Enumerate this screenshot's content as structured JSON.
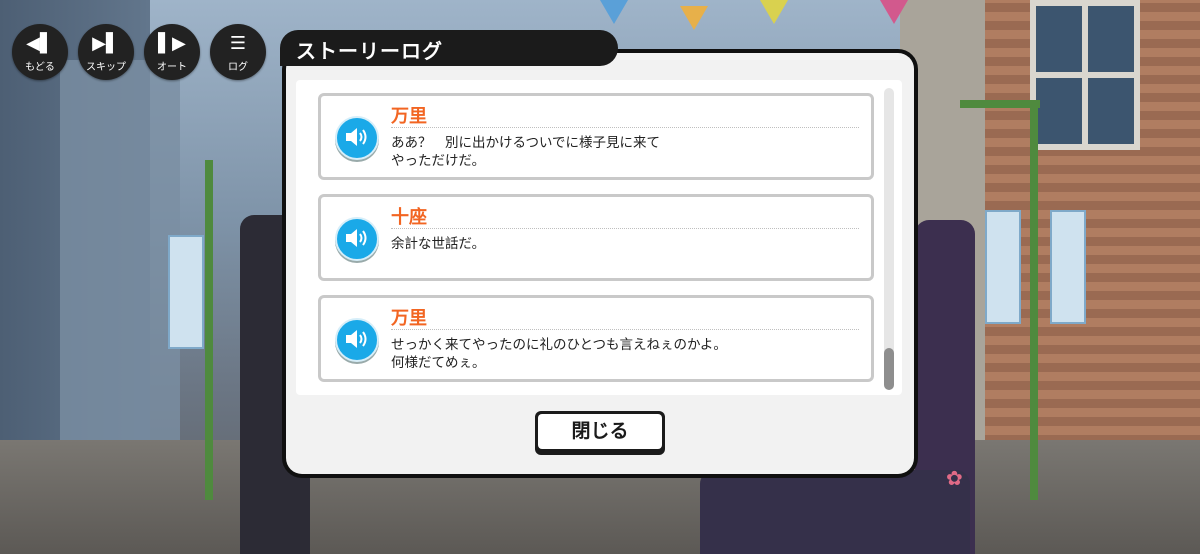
{
  "controls": [
    {
      "label": "もどる",
      "icon": "rewind-icon",
      "glyph": "◀▌"
    },
    {
      "label": "スキップ",
      "icon": "skip-icon",
      "glyph": "▶▌"
    },
    {
      "label": "オート",
      "icon": "auto-icon",
      "glyph": "▌▶"
    },
    {
      "label": "ログ",
      "icon": "log-icon",
      "glyph": "☰"
    }
  ],
  "dialog": {
    "title": "ストーリーログ",
    "close_label": "閉じる"
  },
  "log_entries": [
    {
      "speaker": "万里",
      "line1": "ああ？　別に出かけるついでに様子見に来て",
      "line2": "やっただけだ。"
    },
    {
      "speaker": "十座",
      "line1": "余計な世話だ。",
      "line2": ""
    },
    {
      "speaker": "万里",
      "line1": "せっかく来てやったのに礼のひとつも言えねぇのかよ。",
      "line2": "何様だてめぇ。"
    }
  ],
  "colors": {
    "speaker": "#f26522",
    "voice_button": "#1aa9e8",
    "frame": "#101010"
  }
}
